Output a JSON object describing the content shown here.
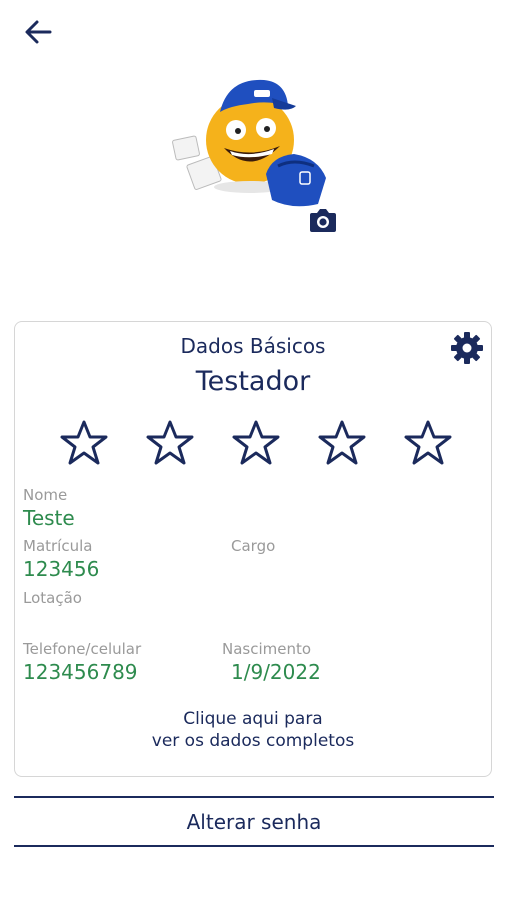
{
  "header": {
    "back_icon": "arrow-left-icon"
  },
  "profile": {
    "avatar_icon": "mascot-avatar",
    "camera_icon": "camera-icon"
  },
  "card": {
    "title": "Dados Básicos",
    "settings_icon": "gear-icon",
    "username": "Testador",
    "rating": {
      "value": 0,
      "max": 5
    },
    "fields": {
      "nome_label": "Nome",
      "nome_value": "Teste",
      "matricula_label": "Matrícula",
      "matricula_value": "123456",
      "cargo_label": "Cargo",
      "cargo_value": "",
      "lotacao_label": "Lotação",
      "lotacao_value": "",
      "telefone_label": "Telefone/celular",
      "telefone_value": "123456789",
      "nascimento_label": "Nascimento",
      "nascimento_value": "1/9/2022"
    },
    "link_line1": "Clique aqui para",
    "link_line2": "ver os dados completos"
  },
  "actions": {
    "change_password": "Alterar senha"
  },
  "colors": {
    "primary": "#1b2a5c",
    "value_green": "#2e8b4e",
    "label_gray": "#9a9a9a",
    "mascot_blue": "#1f4fbf",
    "mascot_yellow": "#f5b21b"
  }
}
